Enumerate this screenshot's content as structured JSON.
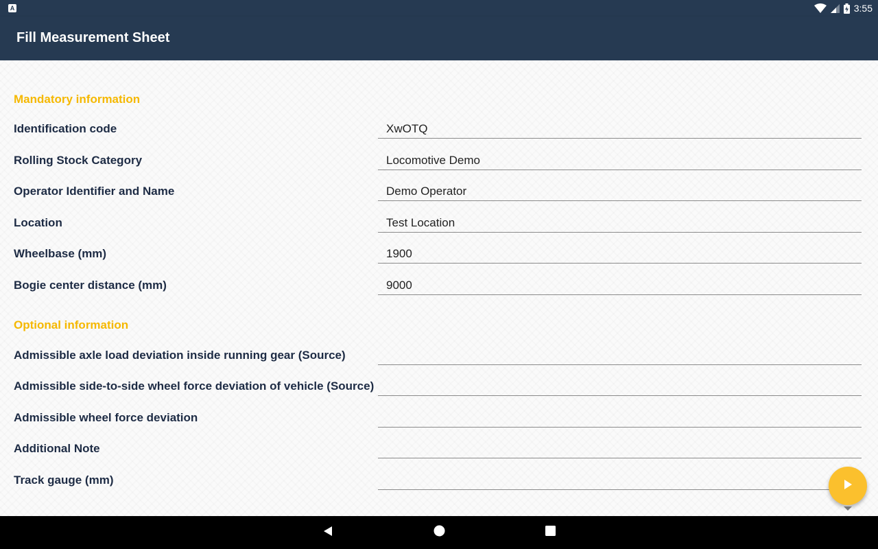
{
  "status_bar": {
    "time": "3:55",
    "notification_icon_letter": "A",
    "icons": [
      "wifi-icon",
      "signal-icon",
      "battery-charging-icon"
    ]
  },
  "app_bar": {
    "title": "Fill Measurement Sheet"
  },
  "mandatory": {
    "title": "Mandatory information",
    "fields": [
      {
        "label": "Identification code",
        "value": "XwOTQ"
      },
      {
        "label": "Rolling Stock Category",
        "value": "Locomotive Demo"
      },
      {
        "label": "Operator Identifier and Name",
        "value": "Demo Operator"
      },
      {
        "label": "Location",
        "value": "Test Location"
      },
      {
        "label": "Wheelbase (mm)",
        "value": "1900"
      },
      {
        "label": "Bogie center distance (mm)",
        "value": "9000"
      }
    ]
  },
  "optional": {
    "title": "Optional information",
    "fields": [
      {
        "label": "Admissible axle load deviation inside running gear (Source)",
        "value": ""
      },
      {
        "label": "Admissible side-to-side wheel force deviation of vehicle (Source)",
        "value": ""
      },
      {
        "label": "Admissible wheel force deviation",
        "value": ""
      },
      {
        "label": "Additional Note",
        "value": ""
      },
      {
        "label": "Track gauge (mm)",
        "value": ""
      }
    ]
  },
  "fab": {
    "icon": "play-arrow-icon"
  },
  "nav_bar": {
    "icons": [
      "back-icon",
      "home-icon",
      "recents-icon"
    ]
  },
  "colors": {
    "app_bar": "#263a52",
    "section_title": "#f5b800",
    "label": "#1d2b44",
    "fab": "#fbc02d"
  }
}
